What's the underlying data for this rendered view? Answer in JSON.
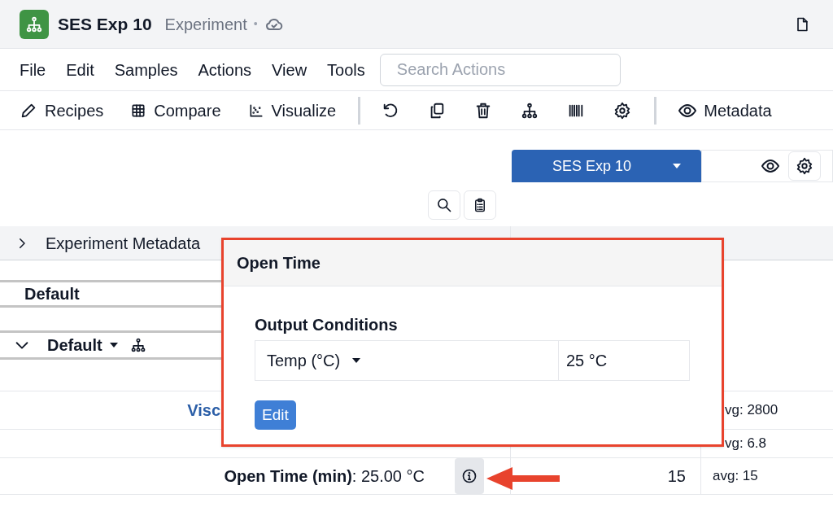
{
  "title_bar": {
    "app_name": "SES Exp 10",
    "doc_type": "Experiment",
    "separator": "•",
    "synced": true
  },
  "menu": [
    "File",
    "Edit",
    "Samples",
    "Actions",
    "View",
    "Tools"
  ],
  "search": {
    "placeholder": "Search Actions"
  },
  "toolbar": {
    "text_buttons": [
      "Recipes",
      "Compare",
      "Visualize"
    ],
    "metadata_button": "Metadata"
  },
  "sample_tab": {
    "label": "SES Exp 10",
    "selected": true
  },
  "metadata_section": {
    "label": "Experiment Metadata",
    "expanded": false
  },
  "group": {
    "label": "Default"
  },
  "subgroup": {
    "label": "Default",
    "expanded": true
  },
  "rows": [
    {
      "label": "Visc",
      "link": true,
      "avg": "vg: 2800"
    },
    {
      "avg": "vg: 6.8"
    },
    {
      "label": "**Open Time (min)**: 25.00 °C",
      "link": false,
      "value": "15",
      "avg": "avg: 15",
      "info": true
    }
  ],
  "popover": {
    "title": "Open Time",
    "section": "Output Conditions",
    "condition_name": "Temp (°C)",
    "condition_value": "25 °C",
    "button": "Edit"
  }
}
